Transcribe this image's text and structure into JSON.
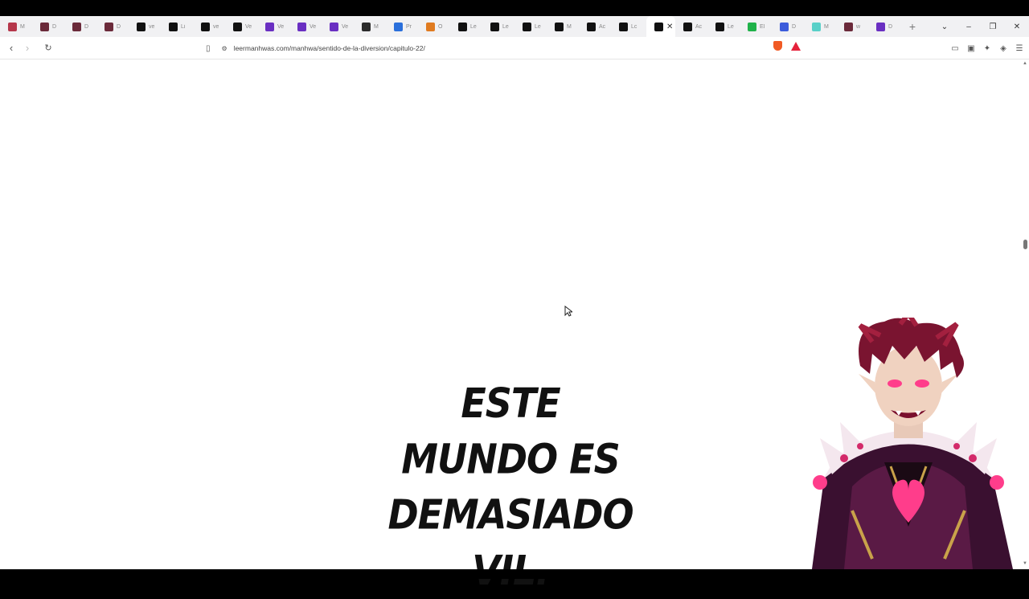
{
  "browser": {
    "tabs": [
      {
        "favicon": "manga-icon",
        "title": "M",
        "color": "#b5374b"
      },
      {
        "favicon": "manga-icon",
        "title": "D",
        "color": "#6b2a3a"
      },
      {
        "favicon": "manga-icon",
        "title": "D",
        "color": "#6b2a3a"
      },
      {
        "favicon": "manga-icon",
        "title": "D",
        "color": "#6b2a3a"
      },
      {
        "favicon": "p-icon",
        "title": "ve",
        "color": "#111111"
      },
      {
        "favicon": "p-icon",
        "title": "Li",
        "color": "#111111"
      },
      {
        "favicon": "p-icon",
        "title": "ve",
        "color": "#111111"
      },
      {
        "favicon": "p-icon",
        "title": "Ve",
        "color": "#111111"
      },
      {
        "favicon": "play-icon",
        "title": "Ve",
        "color": "#6a2fc2"
      },
      {
        "favicon": "play-icon",
        "title": "Ve",
        "color": "#6a2fc2"
      },
      {
        "favicon": "play-icon",
        "title": "Ve",
        "color": "#6a2fc2"
      },
      {
        "favicon": "ae-icon",
        "title": "M",
        "color": "#2b2b2b"
      },
      {
        "favicon": "circle-icon",
        "title": "Pr",
        "color": "#2a6fdb"
      },
      {
        "favicon": "planet-icon",
        "title": "O",
        "color": "#e07b20"
      },
      {
        "favicon": "site-icon",
        "title": "Le",
        "color": "#111111"
      },
      {
        "favicon": "site-icon",
        "title": "Le",
        "color": "#111111"
      },
      {
        "favicon": "site-icon",
        "title": "Le",
        "color": "#111111"
      },
      {
        "favicon": "site-icon",
        "title": "M",
        "color": "#111111"
      },
      {
        "favicon": "site-icon",
        "title": "Ac",
        "color": "#111111"
      },
      {
        "favicon": "site-icon",
        "title": "Lc",
        "color": "#111111"
      }
    ],
    "active_tab": {
      "favicon": "site-icon",
      "color": "#111111"
    },
    "tabs_after": [
      {
        "favicon": "site-icon",
        "title": "Ac",
        "color": "#111111"
      },
      {
        "favicon": "site-icon",
        "title": "Le",
        "color": "#111111"
      },
      {
        "favicon": "gear-green-icon",
        "title": "El",
        "color": "#20b24a"
      },
      {
        "favicon": "grid-icon",
        "title": "D",
        "color": "#3b5bdb"
      },
      {
        "favicon": "wave-icon",
        "title": "M",
        "color": "#59d0c8"
      },
      {
        "favicon": "manga-icon",
        "title": "w",
        "color": "#6b2a3a"
      },
      {
        "favicon": "download-icon",
        "title": "D",
        "color": "#6a2fc2"
      }
    ],
    "url": "leermanhwas.com/manhwa/sentido-de-la-diversion/capitulo-22/"
  },
  "page": {
    "headline_line1": "ESTE MUNDO ES",
    "headline_line2": "DEMASIADO VIL."
  }
}
